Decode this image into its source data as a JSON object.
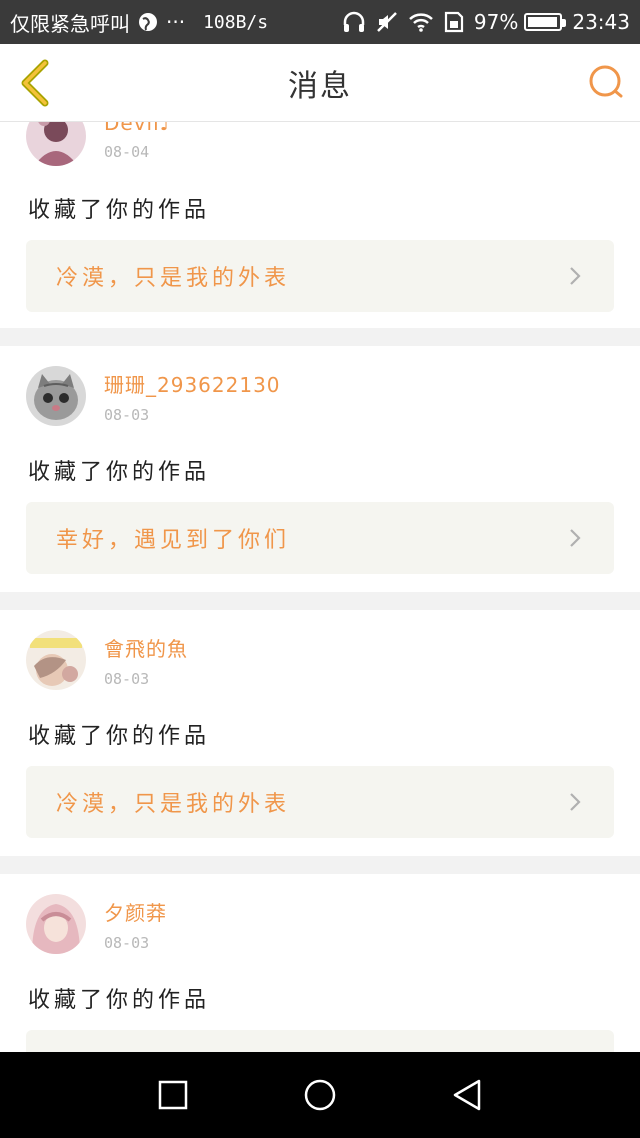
{
  "status_bar": {
    "carrier": "仅限紧急呼叫",
    "more": "···",
    "net_speed": "108B/s",
    "battery_text": "97%",
    "battery_level": 0.97,
    "time": "23:43",
    "icons": [
      "globe-icon",
      "headphones-icon",
      "mute-icon",
      "wifi-icon",
      "sim-icon",
      "battery-icon"
    ]
  },
  "header": {
    "title": "消息",
    "back_icon": "back-chevron-icon",
    "search_icon": "search-icon",
    "accent_color": "#f0964a"
  },
  "feed": [
    {
      "user": "Devil♪",
      "date": "08-04",
      "action": "收藏了你的作品",
      "work": "冷漠，只是我的外表",
      "avatar": "avatar-devil"
    },
    {
      "user": "珊珊_293622130",
      "date": "08-03",
      "action": "收藏了你的作品",
      "work": "幸好，遇见到了你们",
      "avatar": "avatar-cat"
    },
    {
      "user": "會飛的魚",
      "date": "08-03",
      "action": "收藏了你的作品",
      "work": "冷漠，只是我的外表",
      "avatar": "avatar-fish"
    },
    {
      "user": "夕颜莽",
      "date": "08-03",
      "action": "收藏了你的作品",
      "work": "",
      "avatar": "avatar-pink"
    }
  ],
  "nav_bar": {
    "icons": [
      "recent-apps-icon",
      "home-icon",
      "back-triangle-icon"
    ]
  }
}
